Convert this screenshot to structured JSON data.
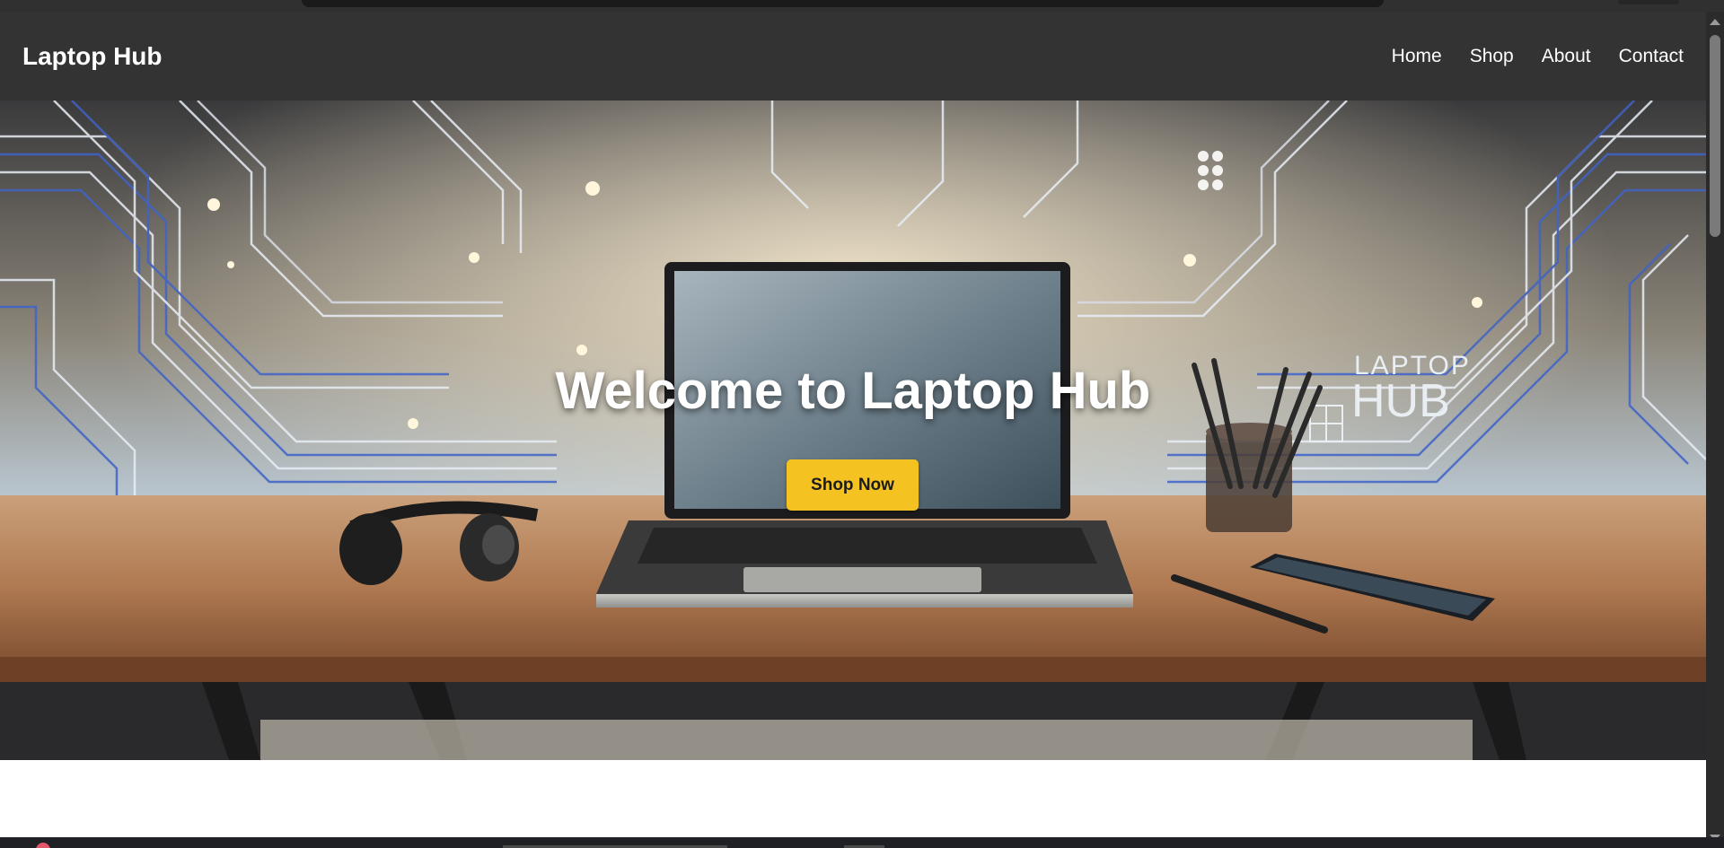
{
  "site": {
    "brand": "Laptop Hub",
    "nav": [
      {
        "label": "Home"
      },
      {
        "label": "Shop"
      },
      {
        "label": "About"
      },
      {
        "label": "Contact"
      }
    ]
  },
  "hero": {
    "title": "Welcome to Laptop Hub",
    "button_label": "Shop Now",
    "image_text": {
      "line1": "LAPTOP",
      "line2": "HUB"
    }
  },
  "colors": {
    "header_bg": "#333333",
    "button_bg": "#f4c322",
    "page_bg": "#ffffff"
  },
  "icons": {
    "scroll_up": "chevron-up-icon",
    "scroll_down": "chevron-down-icon"
  }
}
